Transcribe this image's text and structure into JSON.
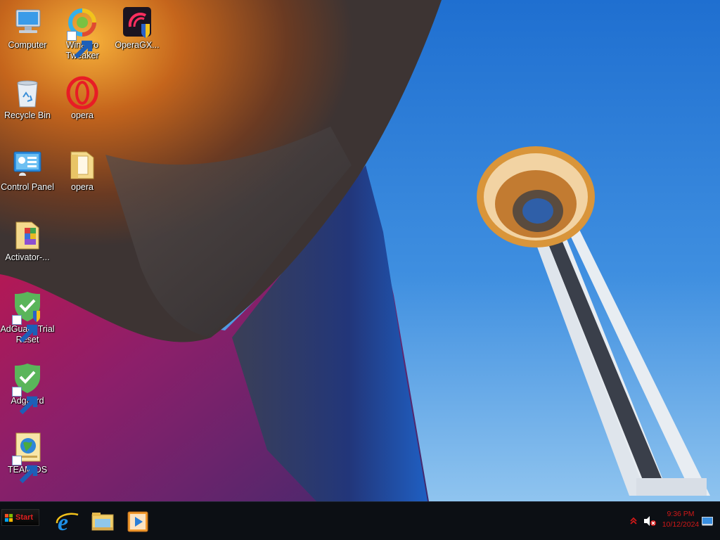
{
  "desktop": {
    "icons": [
      {
        "id": "computer",
        "label": "Computer",
        "icon": "computer-icon",
        "shortcut": false
      },
      {
        "id": "winaero-tweaker",
        "label": "Winaero Tweaker",
        "icon": "winaero-tweaker-icon",
        "shortcut": true
      },
      {
        "id": "operagx-setup",
        "label": "OperaGX...",
        "icon": "operagx-installer-icon",
        "shortcut": false
      },
      {
        "id": "recycle-bin",
        "label": "Recycle Bin",
        "icon": "recycle-bin-icon",
        "shortcut": false
      },
      {
        "id": "opera-browser",
        "label": "opera",
        "icon": "opera-icon",
        "shortcut": false
      },
      {
        "id": "control-panel",
        "label": "Control Panel",
        "icon": "control-panel-icon",
        "shortcut": false
      },
      {
        "id": "opera-folder",
        "label": "opera",
        "icon": "folder-icon",
        "shortcut": false
      },
      {
        "id": "activator-folder",
        "label": "Activator-...",
        "icon": "folder-icon",
        "shortcut": false
      },
      {
        "id": "adguard-trial-reset",
        "label": "AdGuard Trial Reset",
        "icon": "adguard-shield-icon",
        "shortcut": true
      },
      {
        "id": "adguard",
        "label": "Adguard",
        "icon": "adguard-shield-icon",
        "shortcut": true
      },
      {
        "id": "team-os",
        "label": "TEAM OS",
        "icon": "globe-document-icon",
        "shortcut": true
      }
    ]
  },
  "taskbar": {
    "start": {
      "label": "Start",
      "icon": "windows-flag-icon"
    },
    "pinned": [
      {
        "name": "Internet Explorer",
        "icon": "internet-explorer-icon"
      },
      {
        "name": "File Explorer",
        "icon": "file-explorer-icon"
      },
      {
        "name": "Media Player",
        "icon": "media-player-icon"
      }
    ],
    "tray": {
      "chevron_icon": "chevron-up-icon",
      "volume_icon": "volume-muted-icon",
      "time": "9:36 PM",
      "date": "10/12/2024",
      "show_desktop_icon": "show-desktop-icon"
    }
  },
  "colors": {
    "taskbar_bg": "#0c0f14",
    "clock_text": "#d01818",
    "start_label": "#e02020",
    "sky": "#2f7fd6"
  }
}
